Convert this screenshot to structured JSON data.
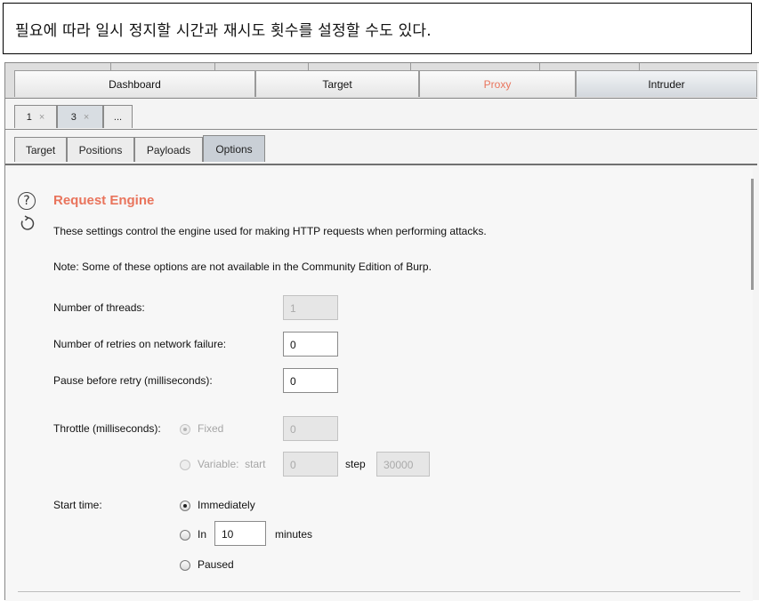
{
  "caption": "필요에 따라 일시 정지할 시간과 재시도 횟수를 설정할 수도 있다.",
  "main_tabs": [
    "Dashboard",
    "Target",
    "Proxy",
    "Intruder"
  ],
  "sub_tabs": [
    {
      "label": "1",
      "close": "×"
    },
    {
      "label": "3",
      "close": "×"
    },
    {
      "label": "..."
    }
  ],
  "option_tabs": [
    "Target",
    "Positions",
    "Payloads",
    "Options"
  ],
  "section": {
    "help_glyph": "?",
    "title": "Request Engine",
    "description": "These settings control the engine used for making HTTP requests when performing attacks.",
    "note": "Note: Some of these options are not available in the Community Edition of Burp."
  },
  "settings": {
    "threads_label": "Number of threads:",
    "threads_value": "1",
    "retries_label": "Number of retries on network failure:",
    "retries_value": "0",
    "pause_label": "Pause before retry (milliseconds):",
    "pause_value": "0",
    "throttle_label": "Throttle (milliseconds):",
    "fixed_label": "Fixed",
    "fixed_value": "0",
    "variable_label": "Variable:  start",
    "variable_start": "0",
    "step_label": "step",
    "step_value": "30000",
    "start_time_label": "Start time:",
    "immediately_label": "Immediately",
    "in_label": "In",
    "in_value": "10",
    "minutes_label": "minutes",
    "paused_label": "Paused"
  },
  "colors": {
    "accent": "#e9745c"
  }
}
